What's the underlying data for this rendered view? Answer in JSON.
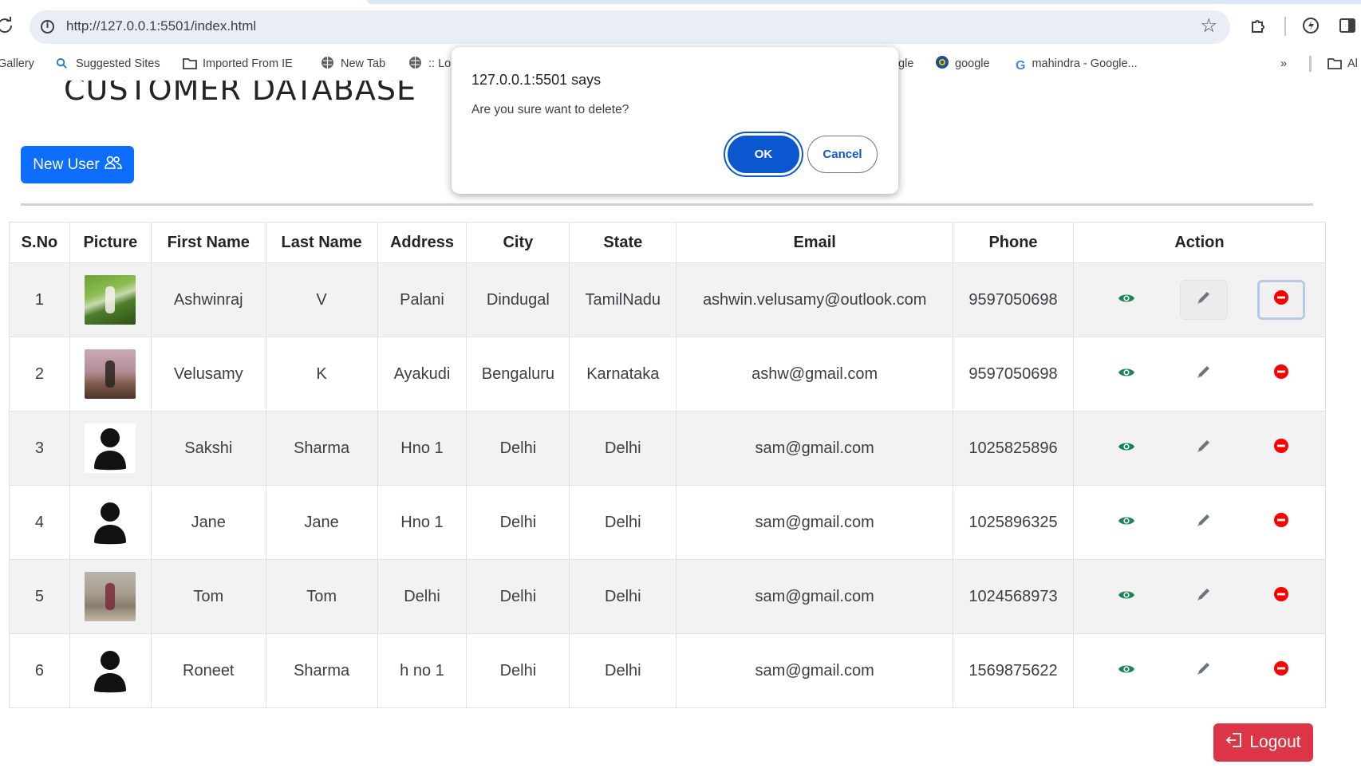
{
  "browser": {
    "url": "http://127.0.0.1:5501/index.html",
    "bookmarks": [
      {
        "label": "Gallery",
        "icon": "none"
      },
      {
        "label": "Suggested Sites",
        "icon": "search-icon"
      },
      {
        "label": "Imported From IE",
        "icon": "folder-icon"
      },
      {
        "label": "New Tab",
        "icon": "globe-icon"
      },
      {
        "label": ":: Lo",
        "icon": "globe-icon"
      },
      {
        "label": "gle",
        "icon": "none"
      },
      {
        "label": "google",
        "icon": "globe-icon"
      },
      {
        "label": "mahindra - Google...",
        "icon": "google-icon"
      },
      {
        "label": "Al",
        "icon": "folder-icon"
      }
    ]
  },
  "page": {
    "title": "CUSTOMER DATABASE",
    "new_user_label": "New User",
    "logout_label": "Logout"
  },
  "table": {
    "headers": [
      "S.No",
      "Picture",
      "First Name",
      "Last Name",
      "Address",
      "City",
      "State",
      "Email",
      "Phone",
      "Action"
    ],
    "rows": [
      {
        "sno": "1",
        "picture": "photo",
        "first": "Ashwinraj",
        "last": "V",
        "address": "Palani",
        "city": "Dindugal",
        "state": "TamilNadu",
        "email": "ashwin.velusamy@outlook.com",
        "phone": "9597050698"
      },
      {
        "sno": "2",
        "picture": "photo",
        "first": "Velusamy",
        "last": "K",
        "address": "Ayakudi",
        "city": "Bengaluru",
        "state": "Karnataka",
        "email": "ashw@gmail.com",
        "phone": "9597050698"
      },
      {
        "sno": "3",
        "picture": "avatar",
        "first": "Sakshi",
        "last": "Sharma",
        "address": "Hno 1",
        "city": "Delhi",
        "state": "Delhi",
        "email": "sam@gmail.com",
        "phone": "1025825896"
      },
      {
        "sno": "4",
        "picture": "avatar",
        "first": "Jane",
        "last": "Jane",
        "address": "Hno 1",
        "city": "Delhi",
        "state": "Delhi",
        "email": "sam@gmail.com",
        "phone": "1025896325"
      },
      {
        "sno": "5",
        "picture": "photo",
        "first": "Tom",
        "last": "Tom",
        "address": "Delhi",
        "city": "Delhi",
        "state": "Delhi",
        "email": "sam@gmail.com",
        "phone": "1024568973"
      },
      {
        "sno": "6",
        "picture": "avatar",
        "first": "Roneet",
        "last": "Sharma",
        "address": "h no 1",
        "city": "Delhi",
        "state": "Delhi",
        "email": "sam@gmail.com",
        "phone": "1569875622"
      }
    ]
  },
  "dialog": {
    "title": "127.0.0.1:5501 says",
    "message": "Are you sure want to delete?",
    "ok_label": "OK",
    "cancel_label": "Cancel"
  },
  "colors": {
    "primary": "#0d6efd",
    "danger": "#dc3545",
    "view_icon": "#198754",
    "delete_icon": "#ff0000",
    "edit_icon": "#6c757d",
    "dialog_accent": "#0b57d0"
  }
}
